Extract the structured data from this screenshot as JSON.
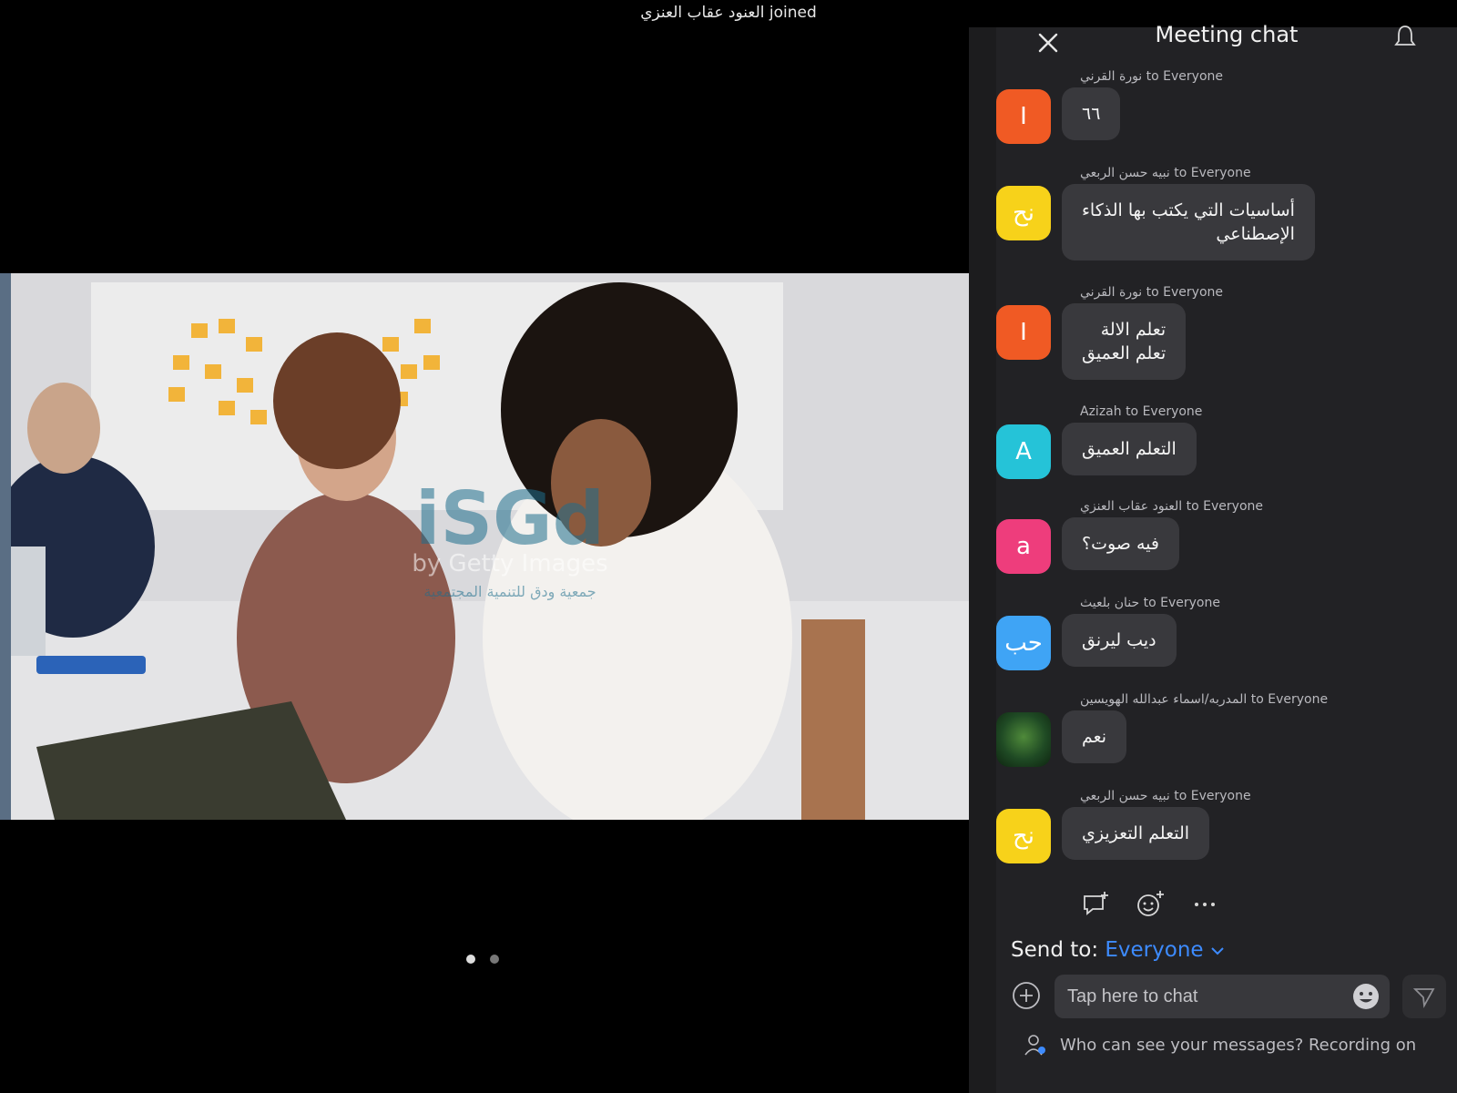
{
  "notification": {
    "text": "العنود عقاب العنزي joined"
  },
  "video": {
    "watermark_logo": "iSGd",
    "watermark_line": "by Getty Images",
    "watermark_org": "جمعية ودق للتنمية المجتمعية"
  },
  "pager": {
    "pages": 2,
    "active": 1
  },
  "chat": {
    "title": "Meeting chat",
    "messages": [
      {
        "sender": "نورة القرني to Everyone",
        "avatar_text": "I",
        "avatar_color": "#f05a24",
        "text": "٦٦"
      },
      {
        "sender": "نبيه حسن الربعي to Everyone",
        "avatar_text": "نح",
        "avatar_color": "#f7d21a",
        "text": "أساسيات التي يكتب بها الذكاء\nالإصطناعي"
      },
      {
        "sender": "نورة القرني to Everyone",
        "avatar_text": "I",
        "avatar_color": "#f05a24",
        "text": "تعلم الالة\nتعلم العميق"
      },
      {
        "sender": "Azizah to Everyone",
        "avatar_text": "A",
        "avatar_color": "#25c3d8",
        "text": "التعلم العميق"
      },
      {
        "sender": "العنود عقاب العنزي to Everyone",
        "avatar_text": "a",
        "avatar_color": "#ee3d7c",
        "text": "فيه صوت؟"
      },
      {
        "sender": "حنان بلعيث to Everyone",
        "avatar_text": "حب",
        "avatar_color": "#3fa4f5",
        "text": "ديب ليرنق"
      },
      {
        "sender": "المدربه/اسماء عبدالله الهويسين to Everyone",
        "avatar_text": "",
        "avatar_color": "#1f4a24",
        "text": "نعم"
      },
      {
        "sender": "نبيه حسن الربعي to Everyone",
        "avatar_text": "نح",
        "avatar_color": "#f7d21a",
        "text": "التعلم التعزيزي"
      }
    ],
    "send_to_label": "Send to:",
    "send_to_value": "Everyone",
    "input_placeholder": "Tap here to chat",
    "privacy_notice": "Who can see your messages? Recording on"
  }
}
